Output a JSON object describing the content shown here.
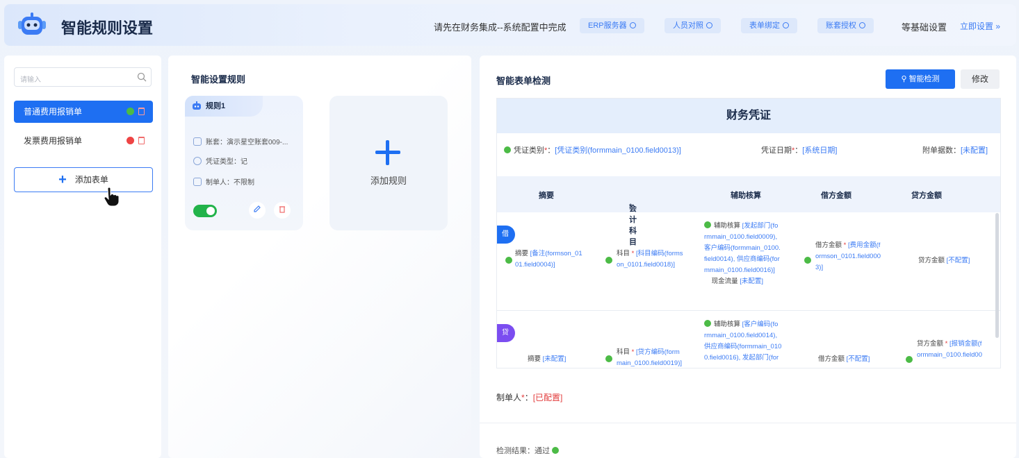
{
  "header": {
    "title": "智能规则设置",
    "notice": "请先在财务集成--系统配置中完成",
    "badges": [
      "ERP服务器",
      "人员对照",
      "表单绑定",
      "账套授权"
    ],
    "basic": "等基础设置",
    "set_now": "立即设置 »"
  },
  "sidebar": {
    "search_placeholder": "请输入",
    "forms": [
      {
        "label": "普通费用报销单",
        "status": "ok"
      },
      {
        "label": "发票费用报销单",
        "status": "error"
      }
    ],
    "add_form": "添加表单"
  },
  "rules": {
    "title": "智能设置规则",
    "card": {
      "name": "规则1",
      "account": "账套：演示星空账套009-...",
      "voucher_type": "凭证类型：记",
      "maker": "制单人：不限制",
      "enabled": true
    },
    "add_rule": "添加规则"
  },
  "detect": {
    "title": "智能表单检测",
    "detect_btn": "智能检测",
    "edit_btn": "修改",
    "voucher_title": "财务凭证",
    "meta": {
      "type_label": "凭证类别",
      "type_value": "[凭证类别(formmain_0100.field0013)]",
      "date_label": "凭证日期",
      "date_value": "[系统日期]",
      "attach_label": "附单据数",
      "attach_value": "[未配置]"
    },
    "columns": [
      "摘要",
      "会计科目",
      "辅助核算",
      "借方金额",
      "贷方金额"
    ],
    "debit_row": {
      "tag": "借",
      "summary_label": "摘要",
      "summary_value_1": "[备注(formson_01",
      "summary_value_2": "01.field0004)]",
      "subject_label": "科目",
      "subject_value_1": "[科目编码(forms",
      "subject_value_2": "on_0101.field0018)]",
      "aux_label": "辅助核算",
      "aux_lines": [
        "[发起部门(fo",
        "rmmain_0100.field0009),",
        "客户编码(formmain_0100.",
        "field0014), 供应商编码(for",
        "mmain_0100.field0016)]"
      ],
      "cash_label": "现金流量",
      "cash_value": "[未配置]",
      "debit_label": "借方金额",
      "debit_value_1": "[费用金额(f",
      "debit_value_2": "ormson_0101.field000",
      "debit_value_3": "3)]",
      "credit_label": "贷方金额",
      "credit_value": "[不配置]"
    },
    "credit_row": {
      "tag": "贷",
      "summary_label": "摘要",
      "summary_value": "[未配置]",
      "subject_label": "科目",
      "subject_value_1": "[贷方编码(form",
      "subject_value_2": "main_0100.field0019)]",
      "aux_label": "辅助核算",
      "aux_lines": [
        "[客户编码(fo",
        "rmmain_0100.field0014),",
        "供应商编码(formmain_010",
        "0.field0016), 发起部门(for"
      ],
      "debit_label": "借方金额",
      "debit_value": "[不配置]",
      "credit_label": "贷方金额",
      "credit_value_1": "[报销金额(f",
      "credit_value_2": "ormmain_0100.field00"
    },
    "maker_label": "制单人",
    "maker_value": "[已配置]",
    "result_label": "检测结果：通过"
  },
  "colors": {
    "primary": "#1e6ff2",
    "success": "#4cbb46",
    "danger": "#ee4444",
    "debit_tag": "#1e6ff2",
    "credit_tag": "#7b4df0"
  }
}
